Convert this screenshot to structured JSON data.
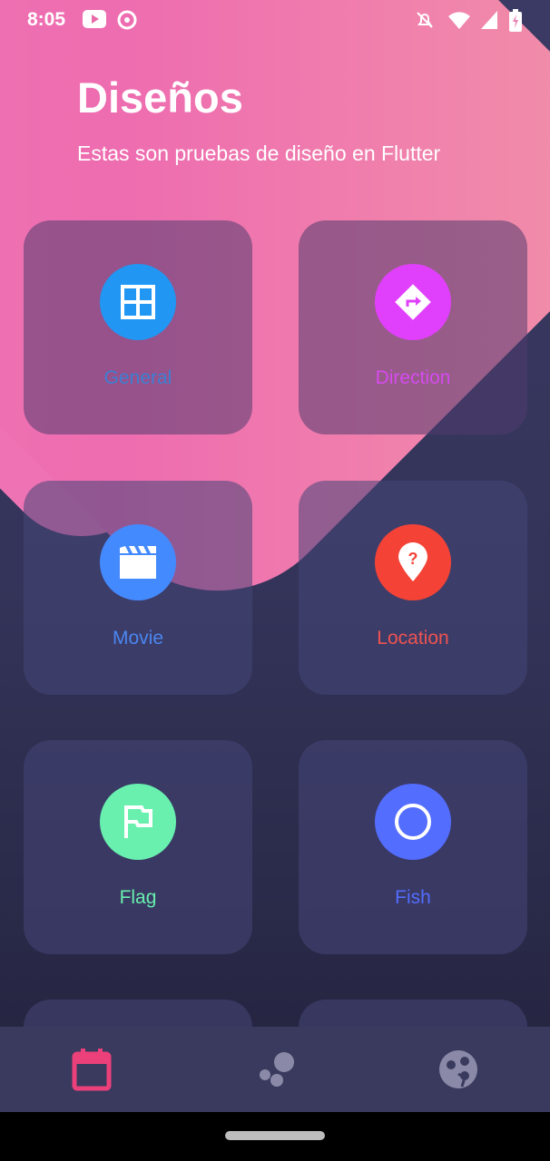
{
  "status_bar": {
    "time": "8:05"
  },
  "header": {
    "title": "Diseños",
    "subtitle": "Estas son pruebas de diseño en Flutter"
  },
  "cards": [
    {
      "label": "General",
      "color": "#3b7fd4",
      "circle": "#2196f3",
      "icon": "grid-icon"
    },
    {
      "label": "Direction",
      "color": "#d64af0",
      "circle": "#e040fb",
      "icon": "direction-icon"
    },
    {
      "label": "Movie",
      "color": "#4a86f0",
      "circle": "#448aff",
      "icon": "movie-icon"
    },
    {
      "label": "Location",
      "color": "#ef5350",
      "circle": "#f44336",
      "icon": "location-icon"
    },
    {
      "label": "Flag",
      "color": "#69f0ae",
      "circle": "#69f0ae",
      "icon": "flag-icon"
    },
    {
      "label": "Fish",
      "color": "#536dfe",
      "circle": "#536dfe",
      "icon": "circle-icon"
    }
  ],
  "bottom_nav": {
    "items": [
      "calendar-icon",
      "bubbles-icon",
      "pie-chart-icon"
    ],
    "active_color": "#ec407a",
    "inactive_color": "#8a8aa8"
  }
}
